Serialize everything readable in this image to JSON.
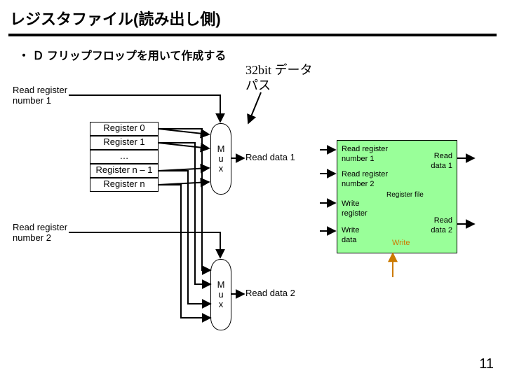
{
  "title": "レジスタファイル(読み出し側)",
  "bullet": "Ｄ フリップフロップを用いて作成する",
  "annot": {
    "line1": "32bit データ",
    "line2": "パス"
  },
  "labels": {
    "rrn1": "Read register\nnumber 1",
    "rrn2": "Read register\nnumber 2",
    "rd1": "Read data 1",
    "rd2": "Read data 2"
  },
  "registers": {
    "r0": "Register 0",
    "r1": "Register 1",
    "dots": "…",
    "rnm1": "Register n – 1",
    "rn": "Register n"
  },
  "mux": {
    "m": "M",
    "u": "u",
    "x": "x"
  },
  "regfile": {
    "rrn1": "Read register\nnumber 1",
    "rrn2": "Read register\nnumber 2",
    "file": "Register file",
    "wreg": "Write\nregister",
    "wdata": "Write\ndata",
    "write": "Write",
    "rd1": "Read\ndata 1",
    "rd2": "Read\ndata 2"
  },
  "pagenum": "11"
}
